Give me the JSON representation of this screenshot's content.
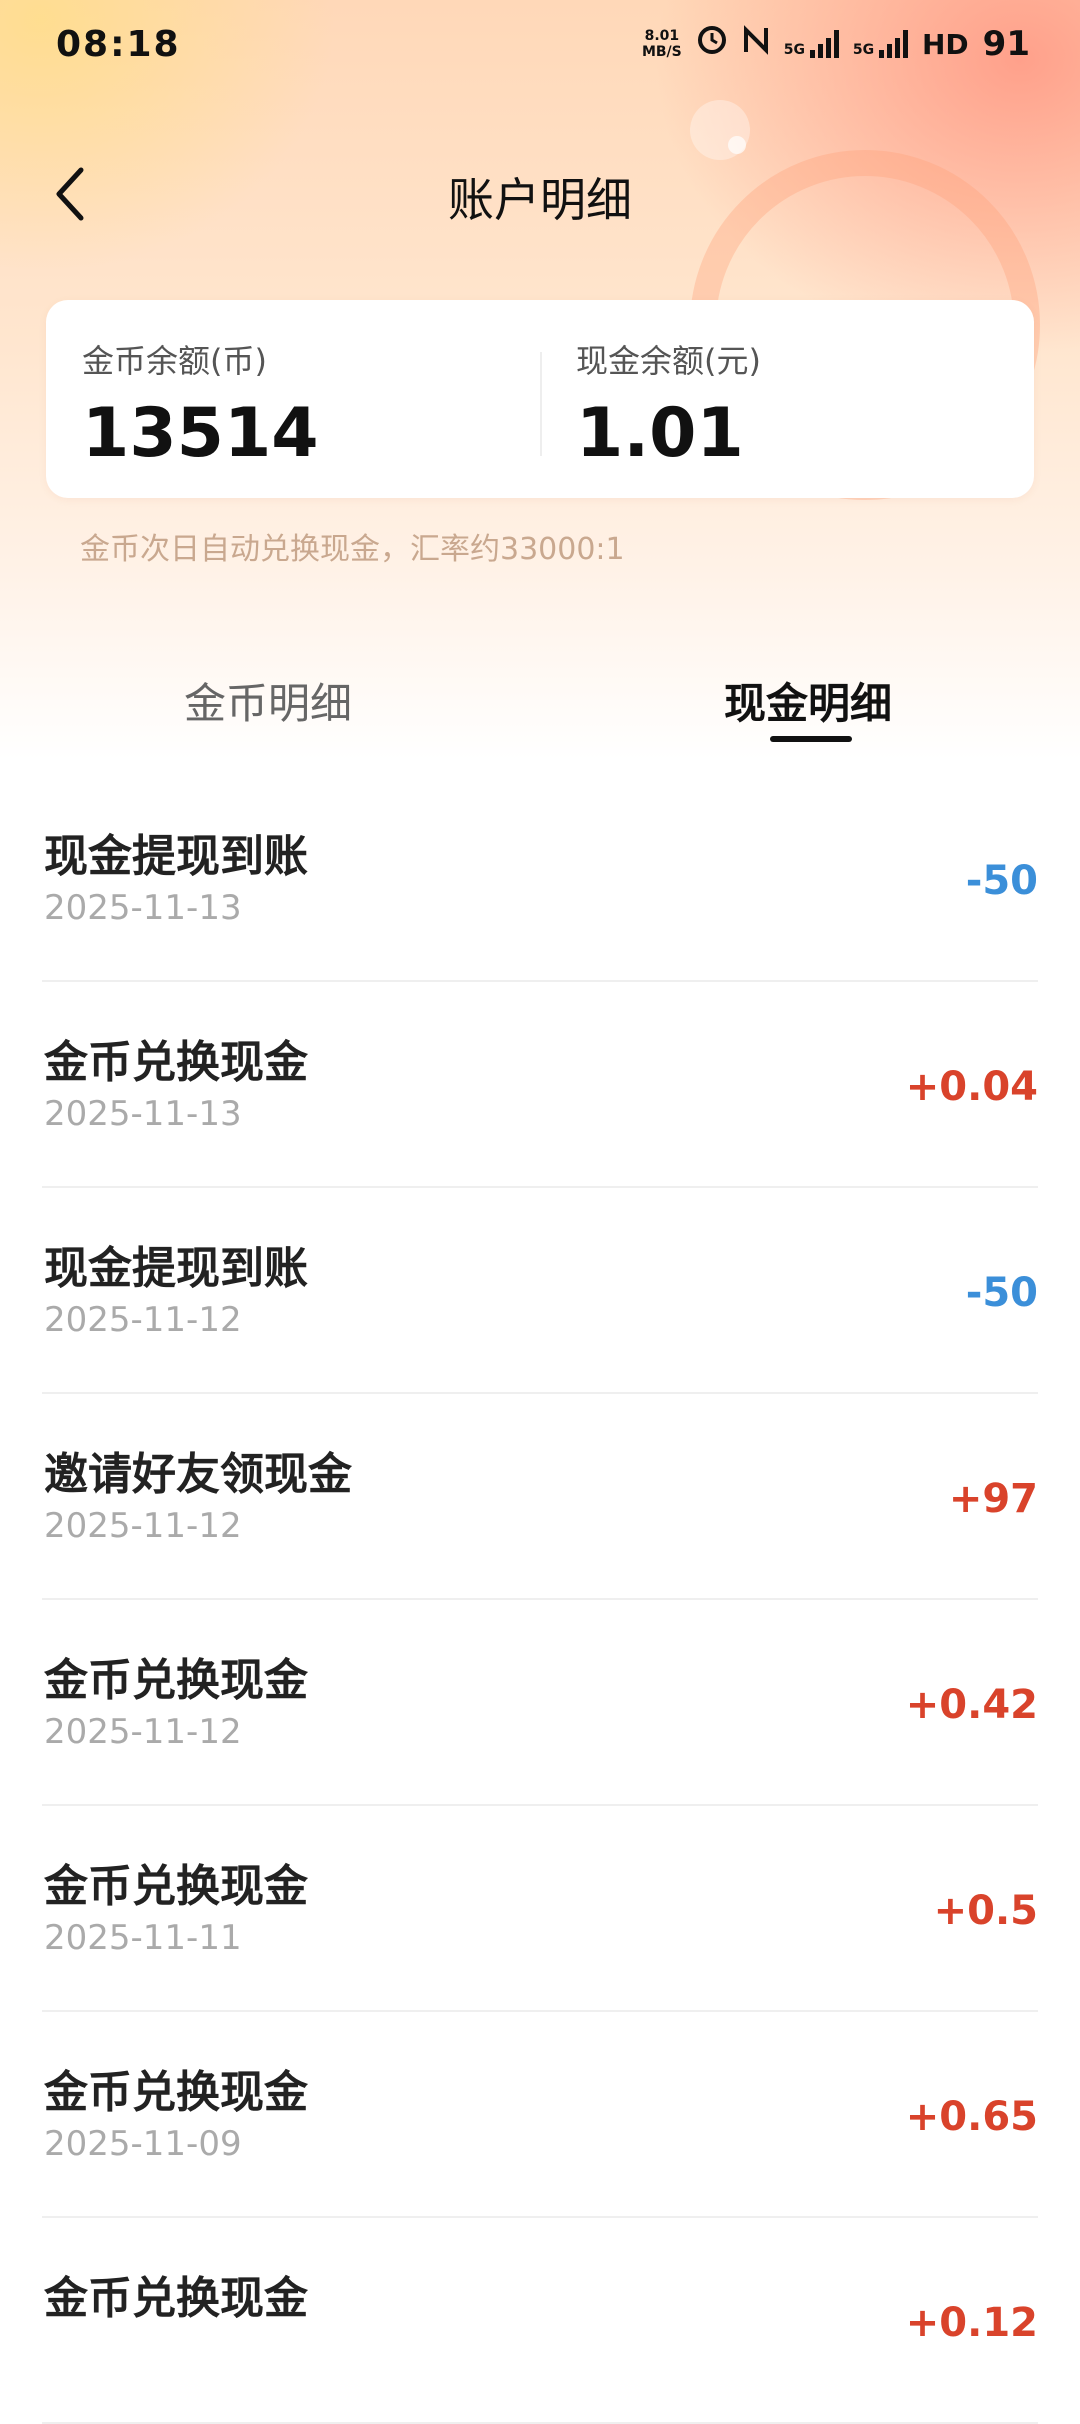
{
  "status_bar": {
    "time": "08:18",
    "net_speed_value": "8.01",
    "net_speed_unit": "MB/S",
    "signal_1": "5G",
    "signal_2": "5G",
    "hd": "HD",
    "battery": "91"
  },
  "nav": {
    "title": "账户明细",
    "back_icon": "chevron-left-icon"
  },
  "balances": {
    "coin_label": "金币余额(币)",
    "coin_value": "13514",
    "cash_label": "现金余额(元)",
    "cash_value": "1.01"
  },
  "note": "金币次日自动兑换现金，汇率约33000:1",
  "tabs": {
    "coin": "金币明细",
    "cash": "现金明细",
    "active": "cash"
  },
  "colors": {
    "positive": "#d9432b",
    "negative": "#3b8fd9"
  },
  "transactions": [
    {
      "title": "现金提现到账",
      "date": "2025-11-13",
      "amount": "-50",
      "type": "negative"
    },
    {
      "title": "金币兑换现金",
      "date": "2025-11-13",
      "amount": "+0.04",
      "type": "positive"
    },
    {
      "title": "现金提现到账",
      "date": "2025-11-12",
      "amount": "-50",
      "type": "negative"
    },
    {
      "title": "邀请好友领现金",
      "date": "2025-11-12",
      "amount": "+97",
      "type": "positive"
    },
    {
      "title": "金币兑换现金",
      "date": "2025-11-12",
      "amount": "+0.42",
      "type": "positive"
    },
    {
      "title": "金币兑换现金",
      "date": "2025-11-11",
      "amount": "+0.5",
      "type": "positive"
    },
    {
      "title": "金币兑换现金",
      "date": "2025-11-09",
      "amount": "+0.65",
      "type": "positive"
    },
    {
      "title": "金币兑换现金",
      "date": "",
      "amount": "+0.12",
      "type": "positive"
    }
  ]
}
